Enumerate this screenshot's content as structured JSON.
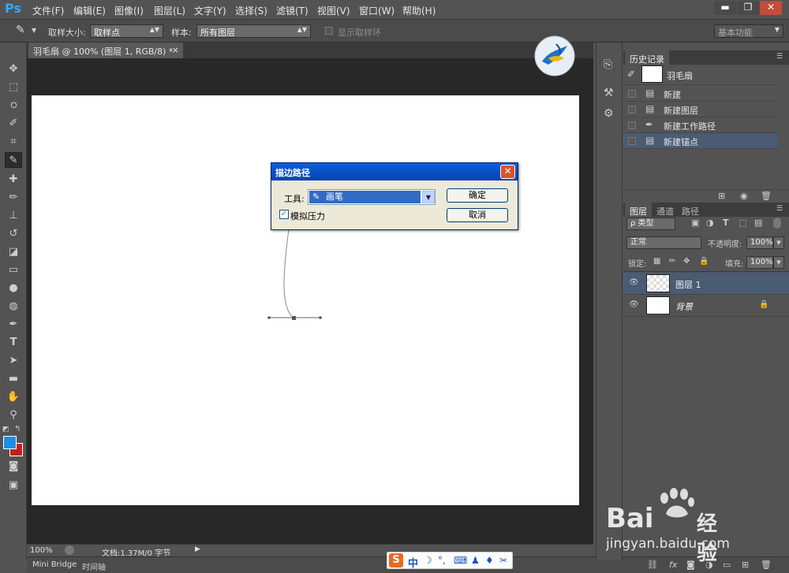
{
  "app": {
    "logo": "Ps"
  },
  "menu": [
    "文件(F)",
    "编辑(E)",
    "图像(I)",
    "图层(L)",
    "文字(Y)",
    "选择(S)",
    "滤镜(T)",
    "视图(V)",
    "窗口(W)",
    "帮助(H)"
  ],
  "window_controls": [
    "▬",
    "❐",
    "✕"
  ],
  "options": {
    "sample_size_label": "取样大小:",
    "sample_size_value": "取样点",
    "sample_label": "样本:",
    "sample_value": "所有图层",
    "show_ring_label": "显示取样环",
    "workspace": "基本功能"
  },
  "document": {
    "tab_title": "羽毛扇 @ 100% (图层 1, RGB/8) *"
  },
  "status": {
    "zoom": "100%",
    "doc_info": "文档:1.37M/0 字节"
  },
  "bottom_tabs": [
    "Mini Bridge",
    "时间轴"
  ],
  "history": {
    "tabs": [
      "历史记录"
    ],
    "snapshot_label": "羽毛扇",
    "items": [
      {
        "label": "新建",
        "icon": "document-icon"
      },
      {
        "label": "新建图层",
        "icon": "document-icon"
      },
      {
        "label": "新建工作路径",
        "icon": "pen-icon"
      },
      {
        "label": "新建锚点",
        "icon": "document-icon",
        "selected": true
      }
    ]
  },
  "layers": {
    "tabs": [
      "图层",
      "通道",
      "路径"
    ],
    "filter_kind": "ρ 类型",
    "blend_mode": "正常",
    "opacity_label": "不透明度:",
    "opacity_value": "100%",
    "lock_label": "锁定:",
    "fill_label": "填充:",
    "fill_value": "100%",
    "items": [
      {
        "name": "图层 1",
        "selected": true
      },
      {
        "name": "背景",
        "italic": true,
        "locked": true
      }
    ]
  },
  "dialog": {
    "title": "描边路径",
    "tool_label": "工具:",
    "tool_value": "画笔",
    "simulate_pressure_label": "模拟压力",
    "simulate_pressure_checked": true,
    "ok_label": "确定",
    "cancel_label": "取消"
  },
  "ime": {
    "mode": "中"
  },
  "watermark": {
    "brand": "Bai",
    "brand2": "经验",
    "url": "jingyan.baidu.com"
  },
  "colors": {
    "foreground": "#1e8fe0",
    "background": "#c0201a",
    "accent": "#31a8ff"
  }
}
